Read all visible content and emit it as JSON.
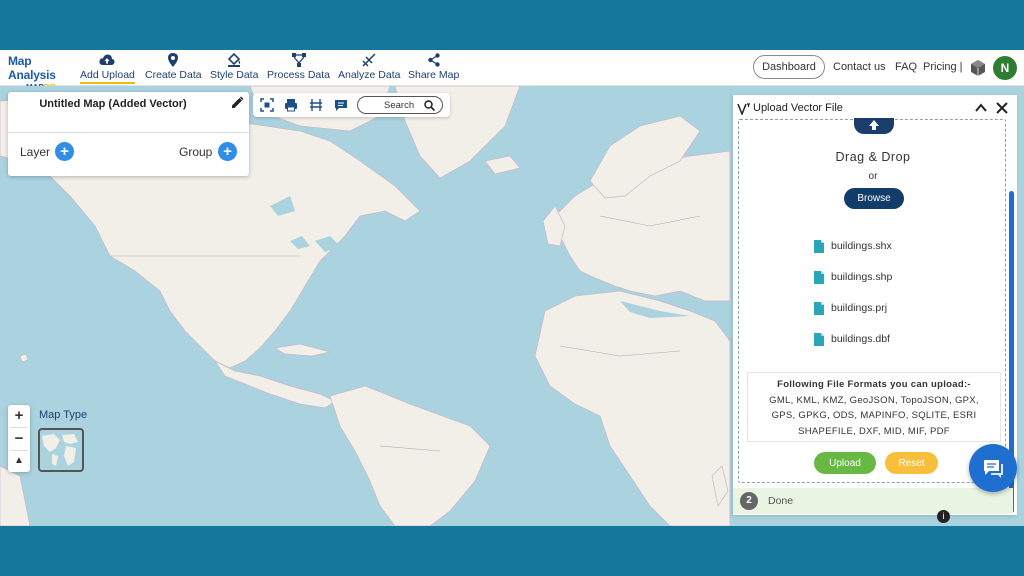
{
  "app": {
    "logo_main": "Map Analysis",
    "logo_sub_a": "MAP",
    "logo_sub_b": "RO"
  },
  "nav": {
    "items": [
      {
        "label": "Add Upload",
        "icon": "cloud-upload-icon",
        "active": true
      },
      {
        "label": "Create Data",
        "icon": "map-pin-icon"
      },
      {
        "label": "Style Data",
        "icon": "paint-bucket-icon"
      },
      {
        "label": "Process Data",
        "icon": "process-nodes-icon"
      },
      {
        "label": "Analyze Data",
        "icon": "analyze-chart-icon"
      },
      {
        "label": "Share Map",
        "icon": "share-icon"
      }
    ],
    "dashboard": "Dashboard",
    "contact": "Contact us",
    "faq": "FAQ",
    "pricing": "Pricing |",
    "avatar_initial": "N"
  },
  "layer_panel": {
    "map_title": "Untitled Map (Added Vector)",
    "layer_label": "Layer",
    "group_label": "Group",
    "plus": "+"
  },
  "toolbar": {
    "search_label": "Search"
  },
  "map_controls": {
    "zoom_in": "+",
    "zoom_out": "−",
    "compass": "▲",
    "map_type_label": "Map Type"
  },
  "upload_panel": {
    "title": "Upload Vector File",
    "drag_drop": "Drag & Drop",
    "or": "or",
    "browse": "Browse",
    "files": [
      "buildings.shx",
      "buildings.shp",
      "buildings.prj",
      "buildings.dbf"
    ],
    "formats_heading": "Following File Formats you can upload:-",
    "formats_line1": "GML, KML, KMZ, GeoJSON, TopoJSON, GPX,",
    "formats_line2": "GPS, GPKG, ODS, MAPINFO, SQLITE, ESRI",
    "formats_line3": "SHAPEFILE, DXF, MID, MIF, PDF",
    "upload": "Upload",
    "reset": "Reset",
    "step_number": "2",
    "step_label": "Done"
  },
  "colors": {
    "brand_blue": "#1c5aa8",
    "accent_yellow": "#f2b81b",
    "upload_green": "#67b944",
    "reset_yellow": "#f7bf3b",
    "ocean": "#aad3df",
    "land": "#f2efe9"
  }
}
